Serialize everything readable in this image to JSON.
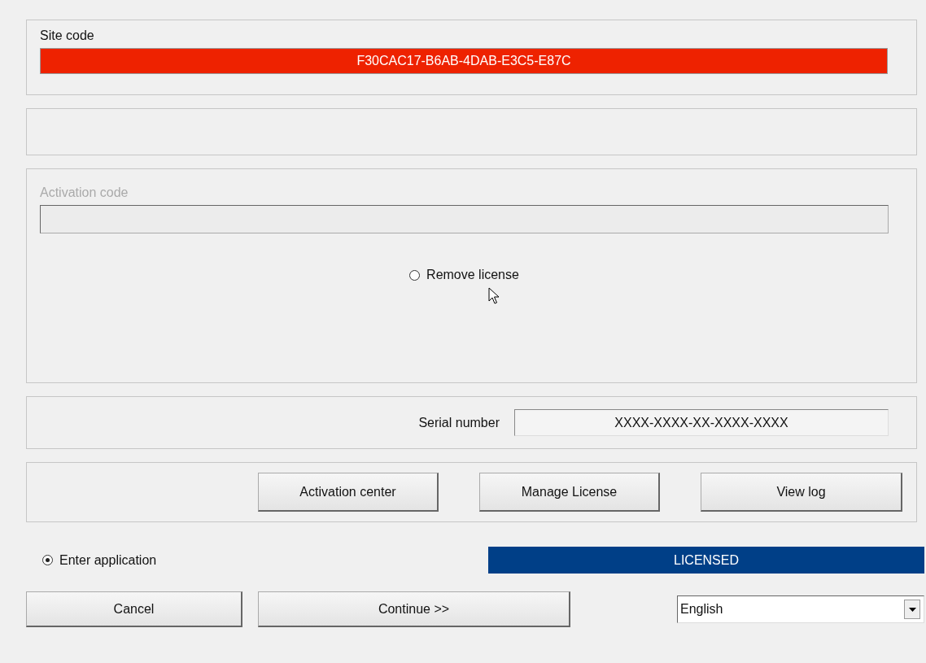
{
  "site_code": {
    "label": "Site code",
    "value": "F30CAC17-B6AB-4DAB-E3C5-E87C"
  },
  "activation": {
    "label": "Activation code",
    "disabled": true,
    "remove_license": {
      "label": "Remove license",
      "selected": false
    }
  },
  "serial": {
    "label": "Serial number",
    "value": "XXXX-XXXX-XX-XXXX-XXXX"
  },
  "buttons": [
    "Activation center",
    "Manage License",
    "View log"
  ],
  "enter_application": {
    "label": "Enter application",
    "selected": true
  },
  "status": "LICENSED",
  "footer_buttons": [
    "Cancel",
    "Continue >>"
  ],
  "language": {
    "value": "English"
  }
}
